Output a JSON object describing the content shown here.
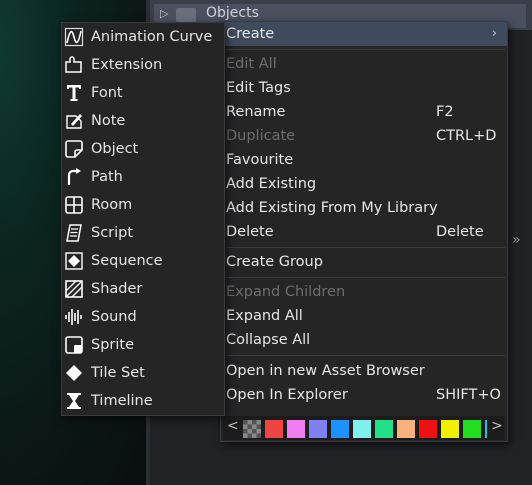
{
  "background": {
    "row_label": "Objects"
  },
  "context_menu": {
    "items": [
      {
        "label": "Create",
        "shortcut": "",
        "disabled": false,
        "highlighted": true,
        "has_submenu": true
      },
      {
        "label": "Edit All",
        "shortcut": "",
        "disabled": true
      },
      {
        "label": "Edit Tags",
        "shortcut": "",
        "disabled": false
      },
      {
        "label": "Rename",
        "shortcut": "F2",
        "disabled": false
      },
      {
        "label": "Duplicate",
        "shortcut": "CTRL+D",
        "disabled": true
      },
      {
        "label": "Favourite",
        "shortcut": "",
        "disabled": false
      },
      {
        "label": "Add Existing",
        "shortcut": "",
        "disabled": false
      },
      {
        "label": "Add Existing From My Library",
        "shortcut": "",
        "disabled": false
      },
      {
        "label": "Delete",
        "shortcut": "Delete",
        "disabled": false
      },
      {
        "label": "Create Group",
        "shortcut": "",
        "disabled": false
      },
      {
        "label": "Expand Children",
        "shortcut": "",
        "disabled": true
      },
      {
        "label": "Expand All",
        "shortcut": "",
        "disabled": false
      },
      {
        "label": "Collapse All",
        "shortcut": "",
        "disabled": false
      },
      {
        "label": "Open in new Asset Browser",
        "shortcut": "",
        "disabled": false
      },
      {
        "label": "Open In Explorer",
        "shortcut": "SHIFT+O",
        "disabled": false
      }
    ],
    "color_swatches": [
      "checker",
      "#ef4444",
      "#f07ef0",
      "#8080f0",
      "#1e90ff",
      "#80f0f0",
      "#22e08a",
      "#f5b27e",
      "#ee1111",
      "#f0f000",
      "#22dd22"
    ]
  },
  "create_submenu": {
    "items": [
      {
        "label": "Animation Curve",
        "icon": "animation-curve-icon"
      },
      {
        "label": "Extension",
        "icon": "extension-icon"
      },
      {
        "label": "Font",
        "icon": "font-icon"
      },
      {
        "label": "Note",
        "icon": "note-icon"
      },
      {
        "label": "Object",
        "icon": "object-icon"
      },
      {
        "label": "Path",
        "icon": "path-icon"
      },
      {
        "label": "Room",
        "icon": "room-icon"
      },
      {
        "label": "Script",
        "icon": "script-icon"
      },
      {
        "label": "Sequence",
        "icon": "sequence-icon"
      },
      {
        "label": "Shader",
        "icon": "shader-icon"
      },
      {
        "label": "Sound",
        "icon": "sound-icon"
      },
      {
        "label": "Sprite",
        "icon": "sprite-icon"
      },
      {
        "label": "Tile Set",
        "icon": "tile-set-icon"
      },
      {
        "label": "Timeline",
        "icon": "timeline-icon"
      }
    ]
  }
}
